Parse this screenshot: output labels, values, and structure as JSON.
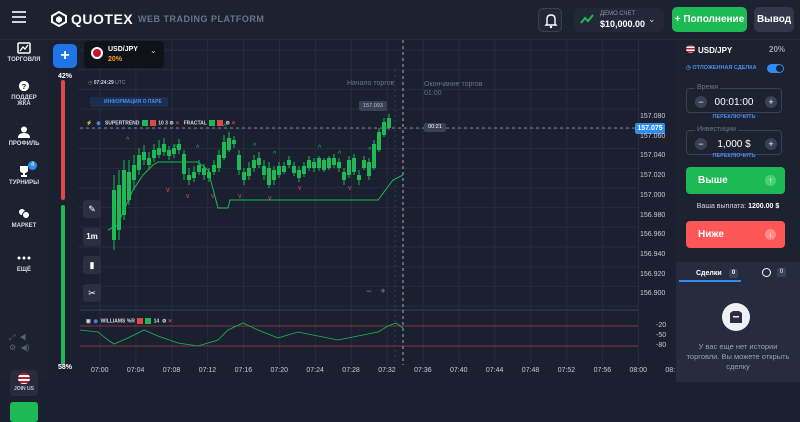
{
  "header": {
    "brand": "QUOTEX",
    "platform": "WEB TRADING PLATFORM",
    "account_type": "ДЕМО СЧЕТ",
    "balance": "$10,000.00",
    "deposit_label": "Пополнение",
    "withdraw_label": "Вывод"
  },
  "sidebar": {
    "items": [
      {
        "label": "ТОРГОВЛЯ",
        "icon": "chart-icon"
      },
      {
        "label": "ПОДДЕРЖКА",
        "icon": "help-icon"
      },
      {
        "label": "ПРОФИЛЬ",
        "icon": "user-icon"
      },
      {
        "label": "ТУРНИРЫ",
        "icon": "trophy-icon",
        "badge": "4"
      },
      {
        "label": "МАРКЕТ",
        "icon": "market-icon"
      },
      {
        "label": "ЕЩЁ",
        "icon": "more-icon"
      }
    ],
    "join_label": "JOIN US"
  },
  "chart_tab": {
    "asset": "USD/JPY",
    "payout": "20%"
  },
  "sentiment": {
    "top": "42%",
    "bottom": "58%"
  },
  "chart": {
    "timestamp_time": "07:24:29",
    "timestamp_zone": "UTC",
    "info_button": "ИНФОРМАЦИЯ О ПАРЕ",
    "indicator1_name": "SUPERTREND",
    "indicator1_params": "10 3",
    "indicator2_name": "FRACTAL",
    "indicator3_name": "WILLIAMS %R",
    "indicator3_param": "14",
    "start_label": "Начало торгов",
    "end_label_1": "Окончание торгов",
    "end_label_2": "01:00",
    "hover_price": "157.093",
    "timer": "00:21",
    "current_price": "157.075",
    "tool_label": "1m"
  },
  "chart_data": {
    "type": "candlestick",
    "x": [
      "07:00",
      "07:04",
      "07:08",
      "07:12",
      "07:16",
      "07:20",
      "07:24",
      "07:28",
      "07:32",
      "07:36",
      "07:40",
      "07:44",
      "07:48",
      "07:52",
      "07:56",
      "08:00",
      "08:"
    ],
    "y_ticks": [
      "157.080",
      "157.060",
      "157.040",
      "157.020",
      "157.000",
      "156.980",
      "156.960",
      "156.940",
      "156.920",
      "156.900"
    ],
    "williams_ticks": [
      "-20",
      "-50",
      "-80"
    ],
    "colors": {
      "up": "#1db954",
      "down": "#e04848",
      "supertrend": "#1db954",
      "current": "#2f8cf0"
    }
  },
  "panel": {
    "asset": "USD/JPY",
    "payout": "20%",
    "pending_label": "ОТЛОЖЕННАЯ СДЕЛКА",
    "time_label": "Время",
    "time_value": "00:01:00",
    "switch_label": "ПЕРЕКЛЮЧИТЬ",
    "investment_label": "Инвестиции",
    "investment_value": "1,000 $",
    "up_label": "Выше",
    "payout_label": "Ваша выплата:",
    "payout_value": "1200.00 $",
    "down_label": "Ниже"
  },
  "deals": {
    "tab_label": "Сделки",
    "tab_count": "0",
    "history_count": "0",
    "empty_text": "У вас еще нет истории торговли. Вы можете открыть сделку"
  }
}
